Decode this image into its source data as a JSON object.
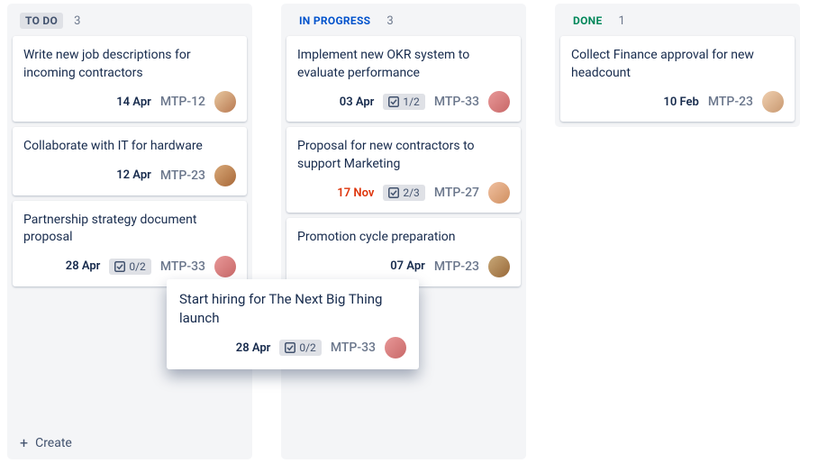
{
  "columns": [
    {
      "id": "todo",
      "title": "TO DO",
      "count": "3",
      "titleClass": "title-todo",
      "cards": [
        {
          "title": "Write new job descriptions for incoming contractors",
          "date": "14 Apr",
          "key": "MTP-12",
          "avatarClass": "avatar-1"
        },
        {
          "title": "Collaborate with IT for hardware",
          "date": "12 Apr",
          "key": "MTP-23",
          "avatarClass": "avatar-2"
        },
        {
          "title": "Partnership strategy document proposal",
          "date": "28 Apr",
          "subtasks": "0/2",
          "key": "MTP-33",
          "avatarClass": "avatar-3"
        }
      ],
      "hasCreate": true,
      "createLabel": "Create"
    },
    {
      "id": "in-progress",
      "title": "IN PROGRESS",
      "count": "3",
      "titleClass": "title-progress",
      "cards": [
        {
          "title": "Implement new OKR system to evaluate performance",
          "date": "03 Apr",
          "subtasks": "1/2",
          "key": "MTP-33",
          "avatarClass": "avatar-3"
        },
        {
          "title": "Proposal for new contractors to support Marketing",
          "date": "17 Nov",
          "dateClass": "date-overdue",
          "subtasks": "2/3",
          "key": "MTP-27",
          "avatarClass": "avatar-4"
        },
        {
          "title": "Promotion cycle preparation",
          "date": "07 Apr",
          "key": "MTP-23",
          "avatarClass": "avatar-5"
        }
      ]
    },
    {
      "id": "done",
      "title": "DONE",
      "count": "1",
      "titleClass": "title-done",
      "cards": [
        {
          "title": "Collect Finance approval for new headcount",
          "date": "10 Feb",
          "key": "MTP-23",
          "avatarClass": "avatar-6"
        }
      ]
    }
  ],
  "floating": {
    "title": "Start hiring for The Next Big Thing launch",
    "date": "28 Apr",
    "subtasks": "0/2",
    "key": "MTP-33",
    "avatarClass": "avatar-3"
  }
}
